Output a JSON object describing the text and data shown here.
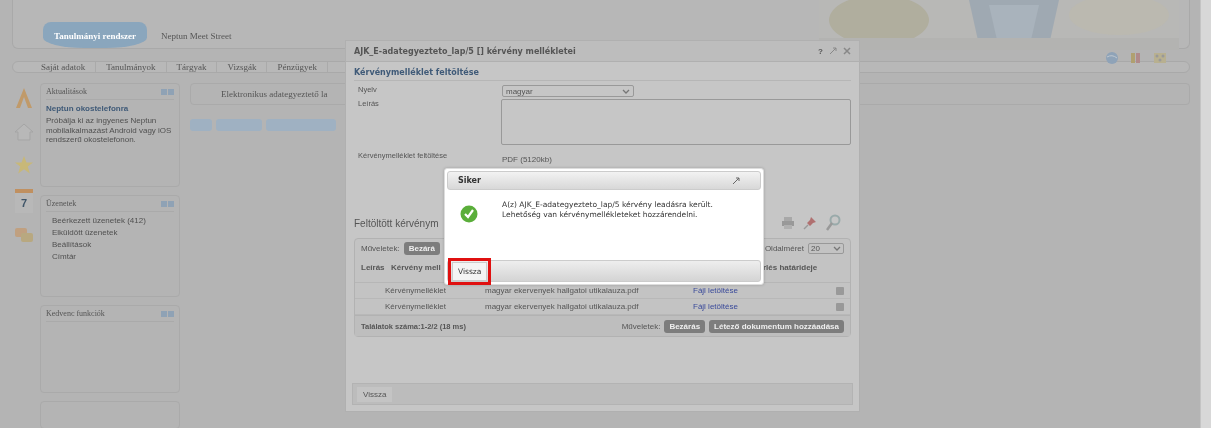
{
  "header": {
    "logo": "Tanulmányi rendszer",
    "subtitle": "Neptun Meet Street"
  },
  "menu": [
    "Saját adatok",
    "Tanulmányok",
    "Tárgyak",
    "Vizsgák",
    "Pénzügyek"
  ],
  "side_icons": {
    "calendar_day": "7"
  },
  "sidebar": [
    {
      "title": "Aktualitások",
      "kind": "news",
      "headline": "Neptun okostelefonra",
      "text": "Próbálja ki az ingyenes Neptun mobilalkalmazást Android vagy iOS rendszerű okostelefonon."
    },
    {
      "title": "Üzenetek",
      "kind": "list",
      "items": [
        "Beérkezett üzenetek (412)",
        "Elküldött üzenetek",
        "Beállítások",
        "Címtár"
      ]
    },
    {
      "title": "Kedvenc funkciók",
      "kind": "empty"
    }
  ],
  "breadcrumb": "Elektronikus adategyeztető la",
  "dialog": {
    "title": "AJK_E-adategyezteto_lap/5 [] kérvény mellékletei",
    "help": "?",
    "section": "Kérvénymelléklet feltöltése",
    "fields": [
      {
        "label": "Nyelv",
        "kind": "select",
        "value": "magyar"
      },
      {
        "label": "Leírás",
        "kind": "textarea"
      },
      {
        "label": "Kérvénymelléklet feltöltése",
        "kind": "info",
        "value": "PDF (5120kb)"
      }
    ],
    "grid_title": "Feltöltött kérvénym",
    "grid": {
      "actions_label": "Műveletek:",
      "actions": [
        "Bezárá"
      ],
      "page_size_label": "Oldalméret",
      "page_size": "20",
      "columns": [
        "Leírás",
        "Kérvény mell",
        "rlés határideje"
      ],
      "rows": [
        {
          "column_1": "Kérvénymelléklet",
          "column_2": "magyar ekervenyek hallgatoi utikalauza.pdf",
          "link": "Fájl letöltése"
        },
        {
          "column_1": "Kérvénymelléklet",
          "column_2": "magyar ekervenyek hallgatoi utikalauza.pdf",
          "link": "Fájl letöltése"
        }
      ],
      "summary": "Találatok száma:1-2/2 (18 ms)",
      "footer_actions_label": "Műveletek:",
      "footer_actions": [
        "Bezárás",
        "Létező dokumentum hozzáadása"
      ]
    },
    "back": "Vissza"
  },
  "success": {
    "title": "Siker",
    "message": "A(z) AJK_E-adategyezteto_lap/5 kérvény leadásra került. Lehetőség van kérvénymellékleteket hozzárendelni.",
    "button": "Vissza",
    "button_highlighted": true
  }
}
